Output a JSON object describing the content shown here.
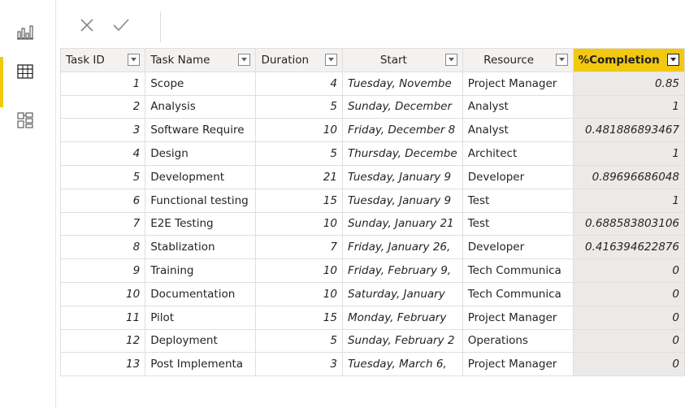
{
  "toolbar": {
    "cancel_label": "×",
    "commit_label": "✓"
  },
  "columns": [
    "Task ID",
    "Task Name",
    "Duration",
    "Start",
    "Resource",
    "%Completion"
  ],
  "rows": [
    {
      "id": "1",
      "name": "Scope",
      "duration": "4",
      "start": "Tuesday, Novembe",
      "resource": "Project Manager",
      "completion": "0.85"
    },
    {
      "id": "2",
      "name": "Analysis",
      "duration": "5",
      "start": "Sunday, December",
      "resource": "Analyst",
      "completion": "1"
    },
    {
      "id": "3",
      "name": "Software Require",
      "duration": "10",
      "start": "Friday, December 8",
      "resource": "Analyst",
      "completion": "0.481886893467"
    },
    {
      "id": "4",
      "name": "Design",
      "duration": "5",
      "start": "Thursday, Decembe",
      "resource": "Architect",
      "completion": "1"
    },
    {
      "id": "5",
      "name": "Development",
      "duration": "21",
      "start": "Tuesday, January 9",
      "resource": "Developer",
      "completion": "0.89696686048"
    },
    {
      "id": "6",
      "name": "Functional testing",
      "duration": "15",
      "start": "Tuesday, January 9",
      "resource": "Test",
      "completion": "1"
    },
    {
      "id": "7",
      "name": "E2E Testing",
      "duration": "10",
      "start": "Sunday, January 21",
      "resource": "Test",
      "completion": "0.688583803106"
    },
    {
      "id": "8",
      "name": "Stablization",
      "duration": "7",
      "start": "Friday, January 26,",
      "resource": "Developer",
      "completion": "0.416394622876"
    },
    {
      "id": "9",
      "name": "Training",
      "duration": "10",
      "start": "Friday, February 9,",
      "resource": "Tech Communica",
      "completion": "0"
    },
    {
      "id": "10",
      "name": "Documentation",
      "duration": "10",
      "start": "Saturday, January",
      "resource": "Tech Communica",
      "completion": "0"
    },
    {
      "id": "11",
      "name": "Pilot",
      "duration": "15",
      "start": "Monday, February",
      "resource": "Project Manager",
      "completion": "0"
    },
    {
      "id": "12",
      "name": "Deployment",
      "duration": "5",
      "start": "Sunday, February 2",
      "resource": "Operations",
      "completion": "0"
    },
    {
      "id": "13",
      "name": "Post Implementa",
      "duration": "3",
      "start": "Tuesday, March 6,",
      "resource": "Project Manager",
      "completion": "0"
    }
  ],
  "sidebar": {
    "items": [
      {
        "icon": "report-view-icon",
        "active": false
      },
      {
        "icon": "data-view-icon",
        "active": true
      },
      {
        "icon": "model-view-icon",
        "active": false
      }
    ]
  },
  "colors": {
    "accent": "#f2c811",
    "header_bg": "#f3f2f1",
    "selected_column_bg": "#eceae8"
  }
}
